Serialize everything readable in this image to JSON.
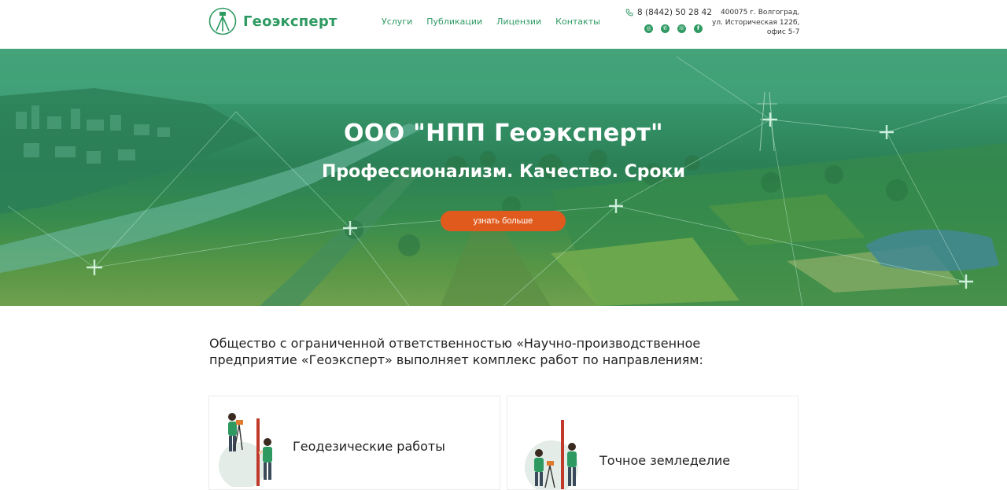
{
  "header": {
    "logo_text": "Геоэксперт",
    "nav": [
      {
        "label": "Услуги"
      },
      {
        "label": "Публикации"
      },
      {
        "label": "Лицензии"
      },
      {
        "label": "Контакты"
      }
    ],
    "phone": "8 (8442) 50 28 42",
    "socials": [
      {
        "icon": "instagram-icon",
        "glyph": "◎"
      },
      {
        "icon": "whatsapp-icon",
        "glyph": "✆"
      },
      {
        "icon": "viber-icon",
        "glyph": "☏"
      },
      {
        "icon": "facebook-icon",
        "glyph": "f"
      }
    ],
    "address_lines": [
      "400075 г. Волгоград,",
      "ул. Историческая 122б,",
      "офис 5-7"
    ]
  },
  "hero": {
    "title": "ООО \"НПП Геоэксперт\"",
    "subtitle": "Профессионализм. Качество. Сроки",
    "button_label": "узнать больше"
  },
  "intro": {
    "text": "Общество с ограниченной ответственностью «Научно-производственное предприятие «Геоэксперт» выполняет комплекс работ по направлениям:"
  },
  "cards": [
    {
      "title": "Геодезические работы"
    },
    {
      "title": "Точное земледелие"
    }
  ],
  "colors": {
    "brand_green": "#2e9a62",
    "accent_orange": "#e05a1e"
  }
}
